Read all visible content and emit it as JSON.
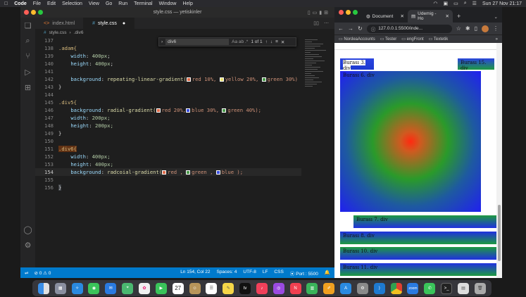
{
  "menubar": {
    "app_name": "Code",
    "items": [
      "File",
      "Edit",
      "Selection",
      "View",
      "Go",
      "Run",
      "Terminal",
      "Window",
      "Help"
    ],
    "clock": "Sun 27 Nov  21:17"
  },
  "vscode": {
    "window_title": "style.css — yetiskinler",
    "tabs": [
      {
        "label": "index.html",
        "icon": "html-file-icon",
        "active": false
      },
      {
        "label": "style.css",
        "icon": "css-file-icon",
        "active": true,
        "modified_marker": "●"
      }
    ],
    "breadcrumb": [
      "style.css",
      "›",
      ".div6"
    ],
    "find": {
      "query": "div6",
      "options": "Aa  ab  .*",
      "result": "1 of 1"
    },
    "line_numbers": [
      "137",
      "138",
      "139",
      "140",
      "141",
      "142",
      "143",
      "144",
      "145",
      "146",
      "147",
      "148",
      "149",
      "150",
      "151",
      "152",
      "153",
      "154",
      "155",
      "156"
    ],
    "current_line": "154",
    "code": {
      "l138": ".adam{",
      "l139_prop": "width",
      "l139_val": "400px",
      "l140_prop": "height",
      "l140_val": "400px",
      "l142_prop": "background",
      "l142_fn": "repeating-linear-gradient(",
      "l142_a": "red 10%,",
      "l142_b": "yellow 20%,",
      "l142_c": "green 30%)",
      "close": "}",
      "l145": ".div5{",
      "l146_prop": "background",
      "l146_fn": "radial-gradient(",
      "l146_a": "red 20%,",
      "l146_b": "blue 30%,",
      "l146_c": "green 40%);",
      "l147_prop": "width",
      "l147_val": "200px;",
      "l148_prop": "height",
      "l148_val": "200px;",
      "l151": ".div6{",
      "l152_prop": "width",
      "l152_val": "400px;",
      "l153_prop": "height",
      "l153_val": "400px;",
      "l154_prop": "background",
      "l154_fn": "radcoial-gradient(",
      "l154_a": "red ,",
      "l154_b": "green ,",
      "l154_c": "blue );"
    },
    "status": {
      "errors": "⊘ 0  ⚠ 0",
      "position": "Ln 154, Col 22",
      "spaces": "Spaces: 4",
      "encoding": "UTF-8",
      "eol": "LF",
      "language": "CSS",
      "port": "⦿ Port : 5500"
    }
  },
  "chrome": {
    "tabs": [
      {
        "label": "Document",
        "active": false
      },
      {
        "label": "Udemig - Ho",
        "active": true
      }
    ],
    "url": "127.0.0.1:5500/inde...",
    "bookmarks": [
      "NordeaAccounts",
      "Tester",
      "engFront",
      "Textetik"
    ],
    "page": {
      "box_3": "Burası 3. div",
      "box_15": "Burası 15. div",
      "box_6": "Burası 6. div",
      "box_7": "Burası 7. div",
      "box_8": "Burası 8. div",
      "box_10": "Burası 10. div",
      "box_11": "Burası 11. div"
    }
  },
  "dock": {
    "apps": [
      "Finder",
      "Launchpad",
      "Safari",
      "Messages",
      "Mail",
      "Maps",
      "Photos",
      "FaceTime",
      "Calendar",
      "Contacts",
      "Reminders",
      "Notes",
      "TV",
      "Music",
      "Podcasts",
      "News",
      "Numbers",
      "Pages",
      "App Store",
      "System Settings",
      "VS Code",
      "Chrome",
      "Zoom",
      "WhatsApp",
      "Terminal",
      "Preview",
      "Trash"
    ],
    "calendar_day": "27",
    "zoom_label": "zoom"
  },
  "colors": {
    "vscode_accent": "#007acc",
    "selector": "#d7ba7d",
    "property": "#9cdcfe",
    "function": "#dcdcaa",
    "number": "#b5cea8"
  }
}
